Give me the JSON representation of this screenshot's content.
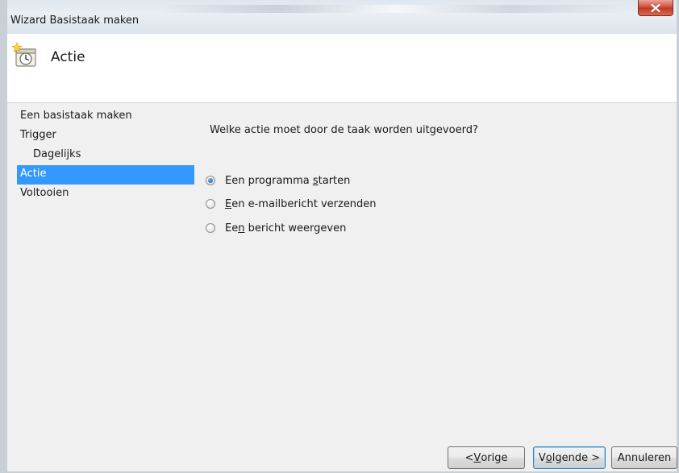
{
  "window": {
    "title": "Wizard Basistaak maken",
    "close_icon": "close-icon"
  },
  "header": {
    "icon": "scheduled-task-clock-icon",
    "title": "Actie"
  },
  "nav": {
    "items": [
      {
        "label": "Een basistaak maken",
        "level": 0,
        "selected": false
      },
      {
        "label": "Trigger",
        "level": 0,
        "selected": false
      },
      {
        "label": "Dagelijks",
        "level": 1,
        "selected": false
      },
      {
        "label": "Actie",
        "level": 0,
        "selected": true
      },
      {
        "label": "Voltooien",
        "level": 0,
        "selected": false
      }
    ]
  },
  "content": {
    "question": "Welke actie moet door de taak worden uitgevoerd?",
    "options": [
      {
        "before": "Een programma ",
        "accel": "s",
        "after": "tarten",
        "checked": true
      },
      {
        "before": "",
        "accel": "E",
        "after": "en e-mailbericht verzenden",
        "checked": false
      },
      {
        "before": "Ee",
        "accel": "n",
        "after": " bericht weergeven",
        "checked": false
      }
    ]
  },
  "buttons": {
    "back": {
      "before": "< ",
      "accel": "V",
      "after": "orige"
    },
    "next": {
      "before": "V",
      "accel": "o",
      "after": "lgende >"
    },
    "cancel": {
      "label": "Annuleren"
    }
  },
  "colors": {
    "selection": "#3399ff",
    "close_button": "#c13a28",
    "panel_background": "#f0f0f0"
  }
}
